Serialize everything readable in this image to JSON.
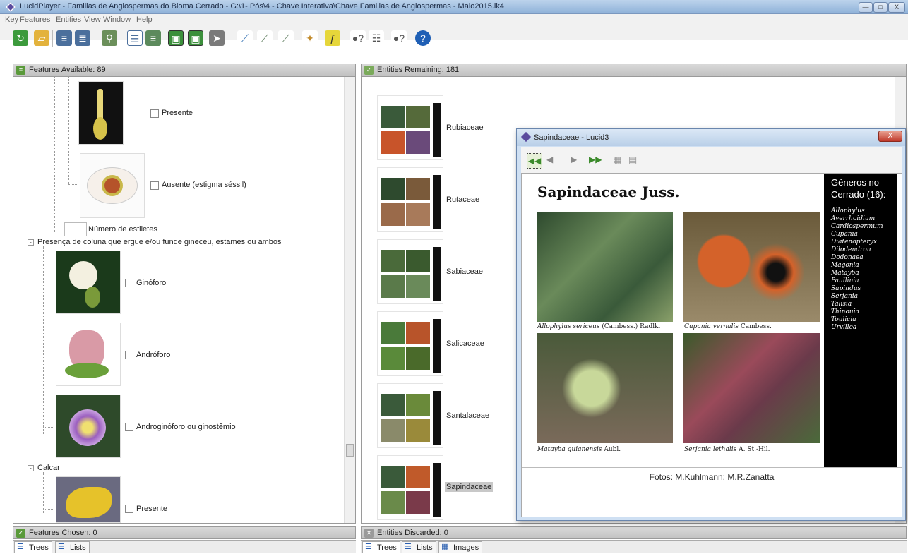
{
  "window": {
    "title": "LucidPlayer - Familias de Angiospermas do Bioma Cerrado - G:\\1- Pós\\4 - Chave Interativa\\Chave Familias de Angiospermas - Maio2015.lk4",
    "min": "—",
    "max": "□",
    "close": "X"
  },
  "menu": [
    "Key",
    "Features",
    "Entities",
    "View",
    "Window",
    "Help"
  ],
  "toolbar_icons": [
    "reset-icon",
    "open-icon",
    "tree-icon",
    "tree-alt-icon",
    "search-icon",
    "list-icon",
    "list-expand-icon",
    "filter-icon",
    "filter-alt-icon",
    "arrow-icon",
    "wand-icon",
    "wand-alt-icon",
    "wand-alt2-icon",
    "pin-icon",
    "feature-icon",
    "help-feature-icon",
    "list-help-icon",
    "entity-help-icon",
    "help-icon"
  ],
  "features_panel": {
    "header": "Features Available: 89",
    "items": [
      {
        "label": "Presente"
      },
      {
        "label": "Ausente (estigma séssil)"
      },
      {
        "label": "Número de estiletes"
      },
      {
        "label": "Presença de coluna que ergue e/ou funde gineceu, estames ou ambos"
      },
      {
        "label": "Ginóforo"
      },
      {
        "label": "Andróforo"
      },
      {
        "label": "Androginóforo ou ginostêmio"
      },
      {
        "label": "Calcar"
      },
      {
        "label": "Presente"
      }
    ]
  },
  "features_chosen": {
    "header": "Features Chosen: 0"
  },
  "left_tabs": {
    "trees": "Trees",
    "lists": "Lists"
  },
  "entities_panel": {
    "header": "Entities Remaining: 181",
    "items": [
      {
        "label": "Rubiaceae"
      },
      {
        "label": "Rutaceae"
      },
      {
        "label": "Sabiaceae"
      },
      {
        "label": "Salicaceae"
      },
      {
        "label": "Santalaceae"
      },
      {
        "label": "Sapindaceae"
      }
    ]
  },
  "entities_discarded": {
    "header": "Entities Discarded: 0"
  },
  "right_tabs": {
    "trees": "Trees",
    "lists": "Lists",
    "images": "Images"
  },
  "popup": {
    "title": "Sapindaceae - Lucid3",
    "close": "X",
    "heading": "Sapindaceae Juss.",
    "captions": [
      {
        "species": "Allophylus sericeus",
        "author": " (Cambess.) Radlk."
      },
      {
        "species": "Cupania vernalis",
        "author": " Cambess."
      },
      {
        "species": "Matayba guianensis",
        "author": " Aubl."
      },
      {
        "species": "Serjania lethalis",
        "author": " A. St.-Hil."
      }
    ],
    "sidebar_title": "Gêneros no Cerrado (16):",
    "genera": [
      "Allophylus",
      "Averrhoidium",
      "Cardiospermum",
      "Cupania",
      "Diatenopteryx",
      "Dilodendron",
      "Dodonaea",
      "Magonia",
      "Matayba",
      "Paullinia",
      "Sapindus",
      "Serjania",
      "Talisia",
      "Thinouia",
      "Toulicia",
      "Urvillea"
    ],
    "footer": "Fotos: M.Kuhlmann; M.R.Zanatta"
  }
}
